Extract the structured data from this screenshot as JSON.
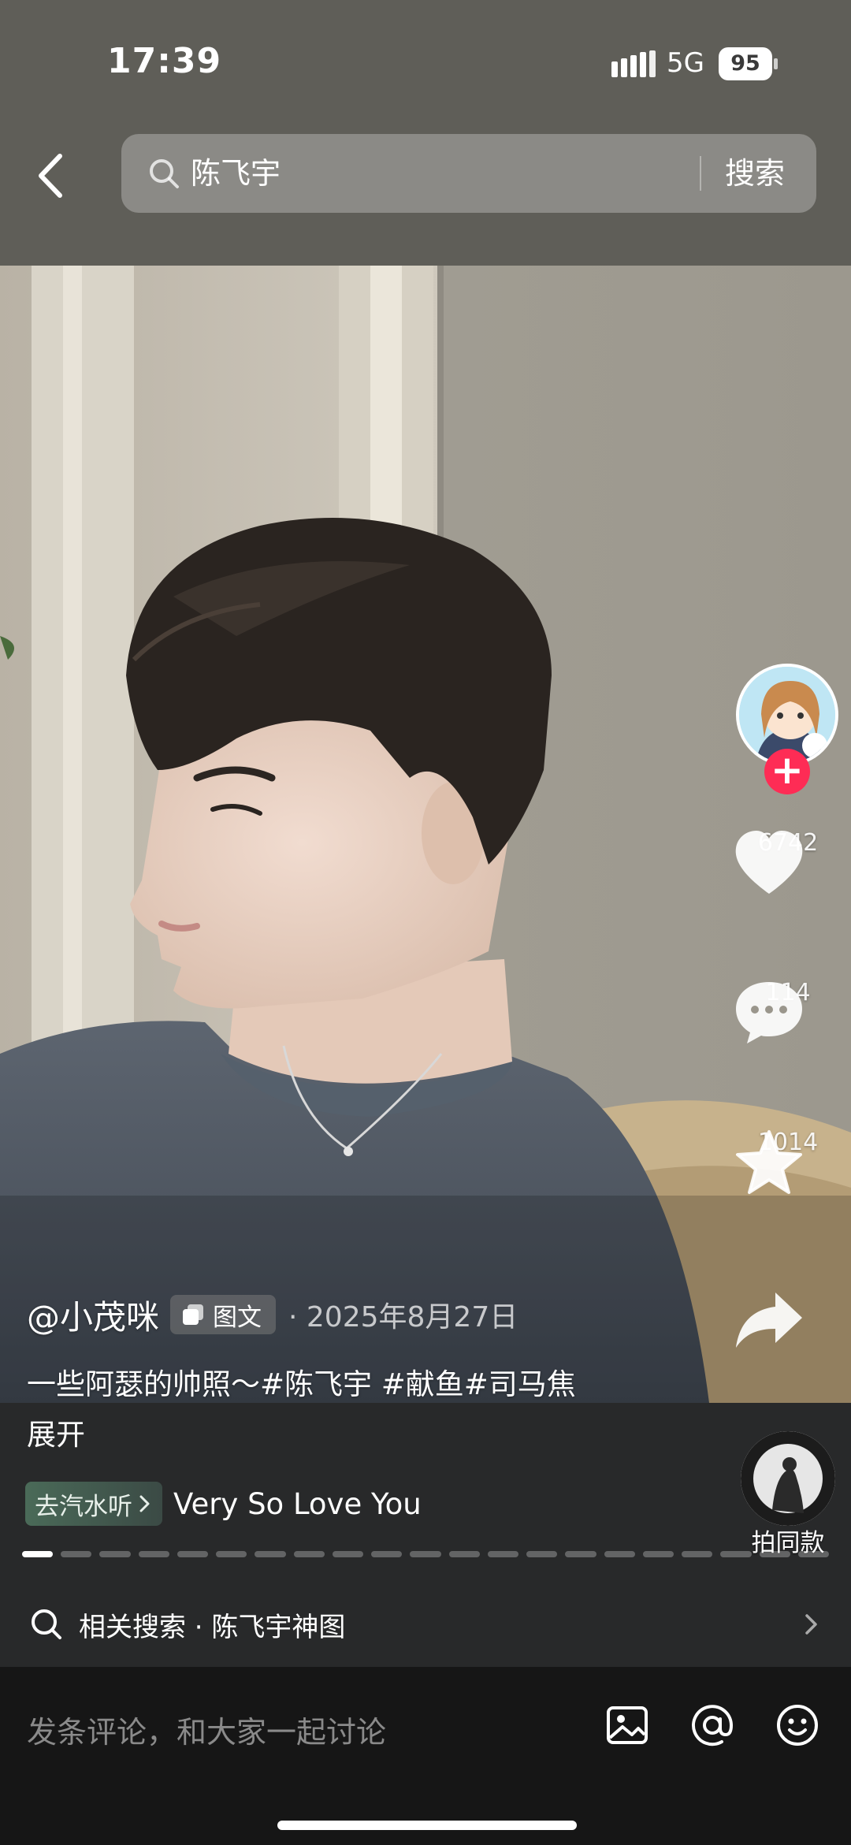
{
  "status_bar": {
    "time": "17:39",
    "network": "5G",
    "battery": "95"
  },
  "search": {
    "query": "陈飞宇",
    "button_label": "搜索"
  },
  "post": {
    "author": "@小茂咪",
    "type_badge": "图文",
    "date": "2025年8月27日",
    "caption": "一些阿瑟的帅照～#陈飞宇 #献鱼#司马焦",
    "expand_label": "展开",
    "page_count": 21,
    "current_page": 1
  },
  "actions": {
    "likes": "6742",
    "comments": "114",
    "favorites": "1014"
  },
  "music": {
    "chip_label": "去汽水听",
    "title": "Very So Love You",
    "same_style_label": "拍同款"
  },
  "related_search": {
    "label": "相关搜索 · 陈飞宇神图"
  },
  "comment_bar": {
    "placeholder": "发条评论，和大家一起讨论"
  },
  "colors": {
    "accent": "#fe2c55",
    "top_bar": "#5f5e58",
    "panel": "#28292a"
  },
  "icons": [
    "back-icon",
    "search-icon",
    "heart-icon",
    "comment-icon",
    "star-icon",
    "share-icon",
    "image-icon",
    "at-icon",
    "emoji-icon"
  ]
}
